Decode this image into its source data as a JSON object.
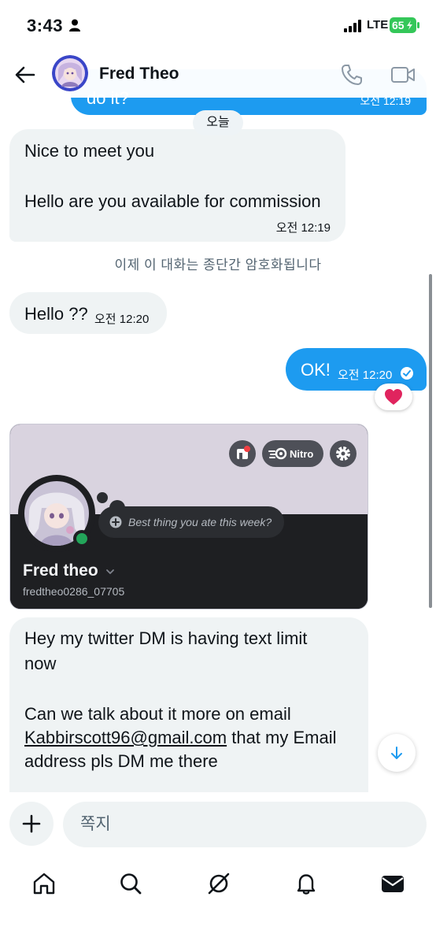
{
  "status_bar": {
    "time": "3:43",
    "network": "LTE",
    "battery_percent": "65",
    "battery_color": "#34c759"
  },
  "header": {
    "contact_name": "Fred Theo",
    "icons": [
      "back-arrow-icon",
      "call-icon",
      "video-icon"
    ]
  },
  "colors": {
    "accent": "#1d9bf0",
    "incoming_bubble": "#eff3f4",
    "text_primary": "#0f1419",
    "text_secondary": "#536471",
    "heart": "#e0245e",
    "discord_dark": "#1e1f22",
    "discord_online": "#23a55a"
  },
  "conversation": {
    "previous_message": {
      "text": "do it?",
      "time": "오전 12:19"
    },
    "date_separator": "오늘",
    "message_1": {
      "line_1": "Nice to meet you",
      "line_2": "Hello are you available for commission",
      "time": "오전 12:19"
    },
    "encryption_notice": "이제 이 대화는 종단간 암호화됩니다",
    "message_2": {
      "text": "Hello ??",
      "time": "오전 12:20"
    },
    "message_3": {
      "text": "OK!",
      "time": "오전 12:20",
      "status": "read-check-icon",
      "reaction": "heart-icon"
    },
    "profile_card": {
      "display_name": "Fred theo",
      "username": "fredtheo0286_07705",
      "status_prompt": "Best thing you ate this week?",
      "nitro_label": "Nitro",
      "online": true
    },
    "message_4": {
      "line_1": "Hey my twitter DM is having text limit",
      "line_2": "now",
      "line_3": "Can we talk about it more on email",
      "email": "Kabbirscott96@gmail.com",
      "line_4_rest": " that my Email",
      "line_5": "address pls DM me there"
    }
  },
  "composer": {
    "placeholder": "쪽지"
  },
  "tab_bar": {
    "items": [
      "home-icon",
      "search-icon",
      "grok-icon",
      "notifications-icon",
      "messages-icon"
    ],
    "active": "messages-icon"
  }
}
